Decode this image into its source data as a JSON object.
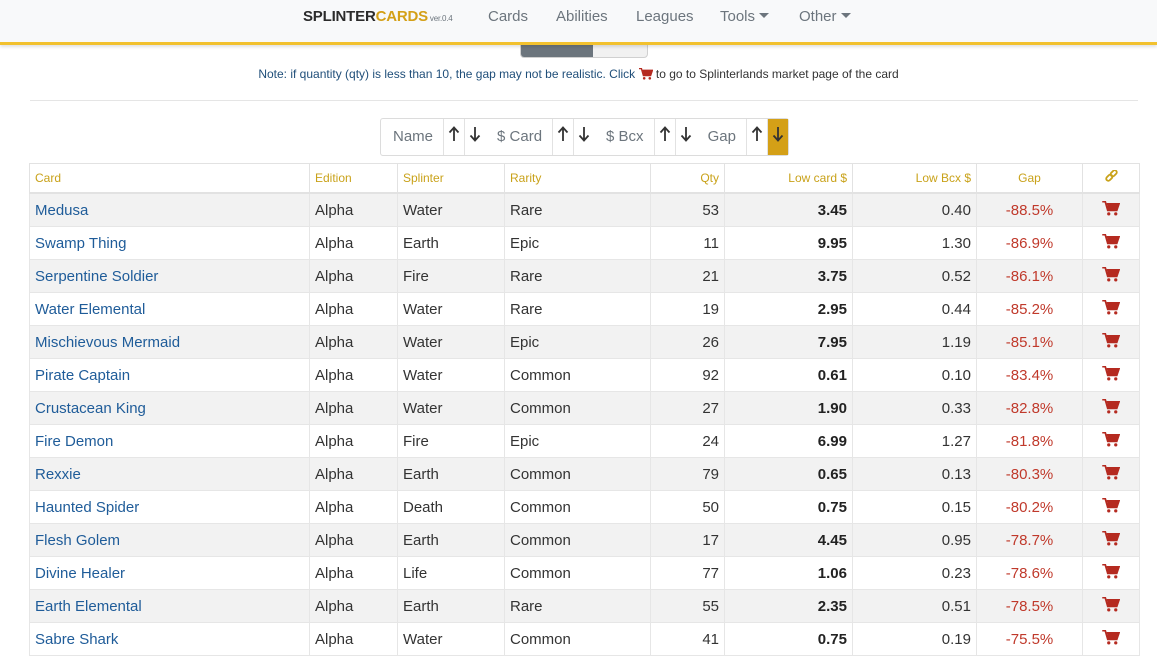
{
  "brand": {
    "part1": "SPLINTER",
    "part2": "CARDS",
    "version": "ver.0.4"
  },
  "nav": {
    "cards": "Cards",
    "abilities": "Abilities",
    "leagues": "Leagues",
    "tools": "Tools",
    "other": "Other"
  },
  "note": {
    "text": "Note: if quantity (qty) is less than 10, the gap may not be realistic. Click",
    "after": "to go to Splinterlands market page of the card"
  },
  "sort": {
    "name": "Name",
    "card_price": "$ Card",
    "bcx_price": "$ Bcx",
    "gap": "Gap",
    "active": "gap-desc"
  },
  "table": {
    "headers": {
      "card": "Card",
      "edition": "Edition",
      "splinter": "Splinter",
      "rarity": "Rarity",
      "qty": "Qty",
      "low_card": "Low card $",
      "low_bcx": "Low Bcx $",
      "gap": "Gap"
    },
    "rows": [
      {
        "card": "Medusa",
        "edition": "Alpha",
        "splinter": "Water",
        "rarity": "Rare",
        "qty": "53",
        "low_card": "3.45",
        "low_bcx": "0.40",
        "gap": "-88.5%"
      },
      {
        "card": "Swamp Thing",
        "edition": "Alpha",
        "splinter": "Earth",
        "rarity": "Epic",
        "qty": "11",
        "low_card": "9.95",
        "low_bcx": "1.30",
        "gap": "-86.9%"
      },
      {
        "card": "Serpentine Soldier",
        "edition": "Alpha",
        "splinter": "Fire",
        "rarity": "Rare",
        "qty": "21",
        "low_card": "3.75",
        "low_bcx": "0.52",
        "gap": "-86.1%"
      },
      {
        "card": "Water Elemental",
        "edition": "Alpha",
        "splinter": "Water",
        "rarity": "Rare",
        "qty": "19",
        "low_card": "2.95",
        "low_bcx": "0.44",
        "gap": "-85.2%"
      },
      {
        "card": "Mischievous Mermaid",
        "edition": "Alpha",
        "splinter": "Water",
        "rarity": "Epic",
        "qty": "26",
        "low_card": "7.95",
        "low_bcx": "1.19",
        "gap": "-85.1%"
      },
      {
        "card": "Pirate Captain",
        "edition": "Alpha",
        "splinter": "Water",
        "rarity": "Common",
        "qty": "92",
        "low_card": "0.61",
        "low_bcx": "0.10",
        "gap": "-83.4%"
      },
      {
        "card": "Crustacean King",
        "edition": "Alpha",
        "splinter": "Water",
        "rarity": "Common",
        "qty": "27",
        "low_card": "1.90",
        "low_bcx": "0.33",
        "gap": "-82.8%"
      },
      {
        "card": "Fire Demon",
        "edition": "Alpha",
        "splinter": "Fire",
        "rarity": "Epic",
        "qty": "24",
        "low_card": "6.99",
        "low_bcx": "1.27",
        "gap": "-81.8%"
      },
      {
        "card": "Rexxie",
        "edition": "Alpha",
        "splinter": "Earth",
        "rarity": "Common",
        "qty": "79",
        "low_card": "0.65",
        "low_bcx": "0.13",
        "gap": "-80.3%"
      },
      {
        "card": "Haunted Spider",
        "edition": "Alpha",
        "splinter": "Death",
        "rarity": "Common",
        "qty": "50",
        "low_card": "0.75",
        "low_bcx": "0.15",
        "gap": "-80.2%"
      },
      {
        "card": "Flesh Golem",
        "edition": "Alpha",
        "splinter": "Earth",
        "rarity": "Common",
        "qty": "17",
        "low_card": "4.45",
        "low_bcx": "0.95",
        "gap": "-78.7%"
      },
      {
        "card": "Divine Healer",
        "edition": "Alpha",
        "splinter": "Life",
        "rarity": "Common",
        "qty": "77",
        "low_card": "1.06",
        "low_bcx": "0.23",
        "gap": "-78.6%"
      },
      {
        "card": "Earth Elemental",
        "edition": "Alpha",
        "splinter": "Earth",
        "rarity": "Rare",
        "qty": "55",
        "low_card": "2.35",
        "low_bcx": "0.51",
        "gap": "-78.5%"
      },
      {
        "card": "Sabre Shark",
        "edition": "Alpha",
        "splinter": "Water",
        "rarity": "Common",
        "qty": "41",
        "low_card": "0.75",
        "low_bcx": "0.19",
        "gap": "-75.5%"
      }
    ]
  },
  "colors": {
    "accent": "#d4a017",
    "header_text": "#c9a21a",
    "link": "#1f5c99",
    "gap_negative": "#c0392b",
    "cart": "#b52a20"
  },
  "icons": {
    "cart": "shopping-cart-icon",
    "link": "link-icon",
    "up": "arrow-up-icon",
    "down": "arrow-down-icon"
  }
}
